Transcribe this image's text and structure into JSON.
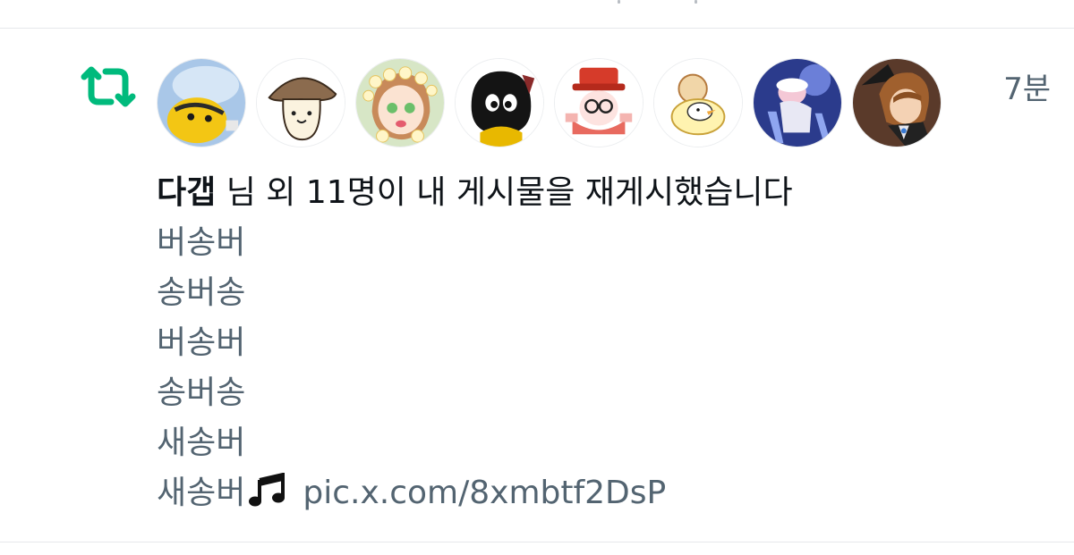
{
  "notification": {
    "type_icon": "retweet-icon",
    "type_icon_color": "#00ba7c",
    "timestamp": "7분",
    "avatars": [
      {
        "icon": "avatar-yellow-bird"
      },
      {
        "icon": "avatar-mushroom"
      },
      {
        "icon": "avatar-flower-crown-girl"
      },
      {
        "icon": "avatar-black-bird"
      },
      {
        "icon": "avatar-red-hat-character"
      },
      {
        "icon": "avatar-duck-in-ring"
      },
      {
        "icon": "avatar-blue-chair-figure"
      },
      {
        "icon": "avatar-brown-hair-boy"
      }
    ],
    "headline": {
      "name": "다갭",
      "rest": " 님 외 11명이 내 게시물을 재게시했습니다"
    },
    "post_lines": [
      "버송버",
      "송버송",
      "버송버",
      "송버송",
      "새송버",
      "새송버"
    ],
    "post_last_icon": "music-note-icon",
    "post_link": "pic.x.com/8xmbtf2DsP"
  },
  "colors": {
    "text_primary": "#0f1419",
    "text_secondary": "#536471",
    "divider": "#e6e8eb",
    "accent_green": "#00ba7c"
  }
}
